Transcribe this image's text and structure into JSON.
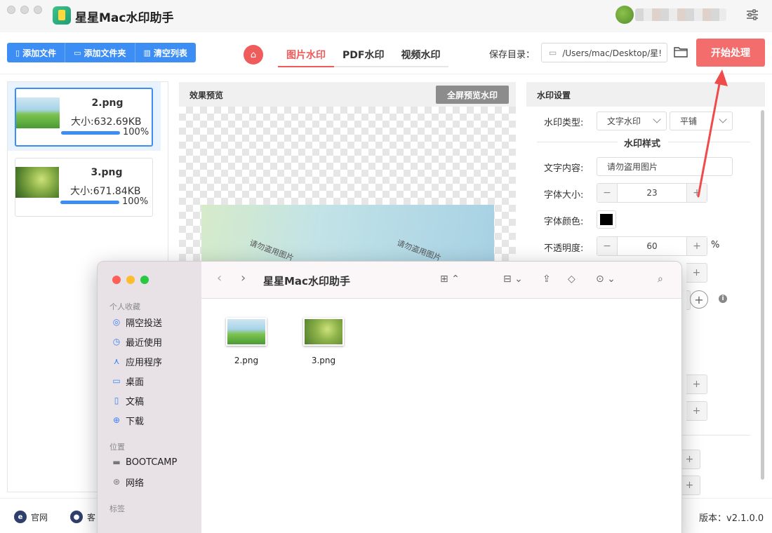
{
  "app": {
    "title": "星星Mac水印助手",
    "accent": "#3c8ef5",
    "brand_red": "#ef5a5a"
  },
  "toolbar": {
    "add_file": "添加文件",
    "add_folder": "添加文件夹",
    "clear_list": "清空列表"
  },
  "tabs": [
    {
      "label": "图片水印",
      "active": true
    },
    {
      "label": "PDF水印",
      "active": false
    },
    {
      "label": "视频水印",
      "active": false
    }
  ],
  "save": {
    "label": "保存目录：",
    "path": "/Users/mac/Desktop/星!",
    "start_label": "开始处理"
  },
  "files": [
    {
      "name": "2.png",
      "size": "大小:632.69KB",
      "progress": "100%",
      "progress_value": 100,
      "selected": true
    },
    {
      "name": "3.png",
      "size": "大小:671.84KB",
      "progress": "100%",
      "progress_value": 100,
      "selected": false
    }
  ],
  "preview": {
    "title": "效果预览",
    "fullscreen_label": "全屏预览水印",
    "watermark_text": "请勿盗用图片"
  },
  "settings": {
    "title": "水印设置",
    "type_label": "水印类型:",
    "type_value": "文字水印",
    "layout_value": "平铺",
    "style_section": "水印样式",
    "text_label": "文字内容:",
    "text_value": "请勿盗用图片",
    "font_size_label": "字体大小:",
    "font_size_value": "23",
    "font_color_label": "字体颜色:",
    "font_color": "#000000",
    "opacity_label": "不透明度:",
    "opacity_value": "60",
    "opacity_unit": "%"
  },
  "footer": {
    "official": "官网",
    "service": "客",
    "version": "版本：v2.1.0.0"
  },
  "finder": {
    "title": "星星Mac水印助手",
    "groups": {
      "favorites": "个人收藏",
      "locations": "位置",
      "tags": "标签"
    },
    "favorites": [
      {
        "label": "隔空投送",
        "icon": "airdrop-icon"
      },
      {
        "label": "最近使用",
        "icon": "clock-icon"
      },
      {
        "label": "应用程序",
        "icon": "apps-icon"
      },
      {
        "label": "桌面",
        "icon": "desktop-icon"
      },
      {
        "label": "文稿",
        "icon": "document-icon"
      },
      {
        "label": "下载",
        "icon": "download-icon"
      }
    ],
    "locations": [
      {
        "label": "BOOTCAMP",
        "icon": "drive-icon"
      },
      {
        "label": "网络",
        "icon": "network-icon"
      }
    ],
    "files": [
      {
        "name": "2.png"
      },
      {
        "name": "3.png"
      }
    ]
  }
}
